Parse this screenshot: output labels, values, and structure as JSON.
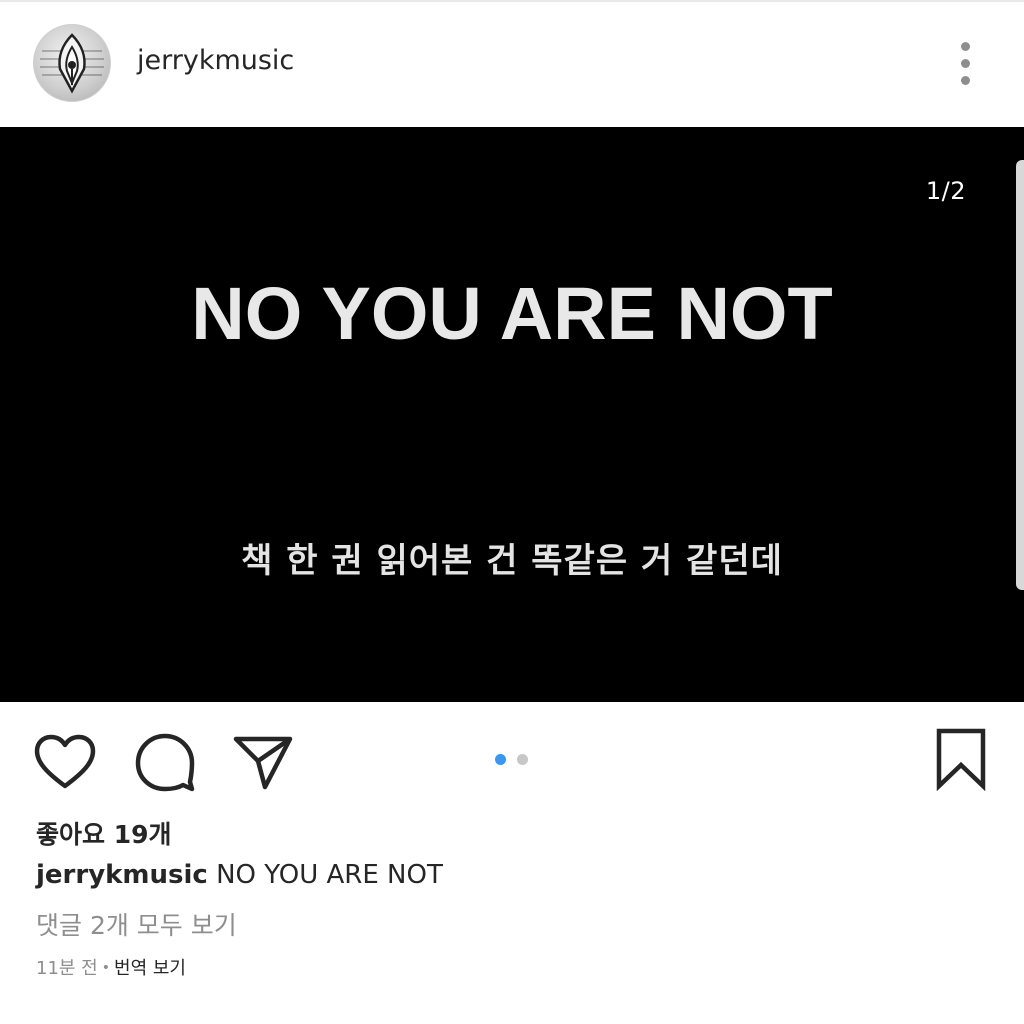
{
  "post": {
    "username": "jerrykmusic",
    "avatar_icon": "fountain-pen-nib-icon",
    "more_icon": "more-vertical-icon"
  },
  "media": {
    "counter": "1/2",
    "headline": "NO YOU ARE NOT",
    "subtitle": "책 한 권 읽어본 건 똑같은 거 같던데",
    "background_color": "#000000"
  },
  "actions": {
    "like_icon": "heart-icon",
    "comment_icon": "comment-bubble-icon",
    "share_icon": "paper-plane-icon",
    "save_icon": "bookmark-icon",
    "carousel": {
      "total": 2,
      "active_index": 0,
      "active_color": "#3897f0",
      "inactive_color": "#c7c7c7"
    }
  },
  "details": {
    "likes": "좋아요 19개",
    "caption_user": "jerrykmusic",
    "caption_text": "NO YOU ARE NOT",
    "view_comments": "댓글 2개 모두 보기",
    "time": "11분 전",
    "separator": "•",
    "translate": "번역 보기"
  }
}
